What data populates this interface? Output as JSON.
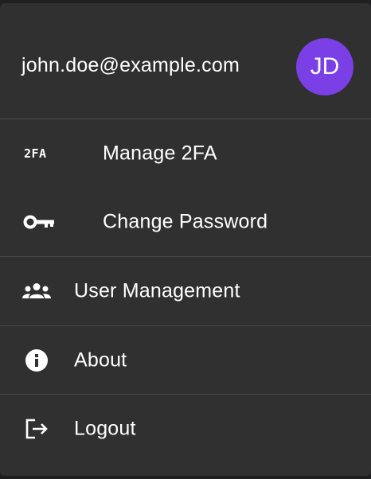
{
  "account": {
    "email": "john.doe@example.com",
    "avatar_initials": "JD",
    "avatar_color": "#7b3fe6"
  },
  "menu": {
    "security": {
      "manage_2fa": {
        "label": "Manage 2FA",
        "icon": "2fa-icon",
        "icon_text": "2FA"
      },
      "change_password": {
        "label": "Change Password",
        "icon": "key-icon"
      }
    },
    "user_management": {
      "label": "User Management",
      "icon": "people-icon"
    },
    "about": {
      "label": "About",
      "icon": "info-icon"
    },
    "logout": {
      "label": "Logout",
      "icon": "logout-icon"
    }
  },
  "colors": {
    "menu_background": "#303030",
    "divider": "#4a4a4a",
    "text": "#ffffff"
  }
}
